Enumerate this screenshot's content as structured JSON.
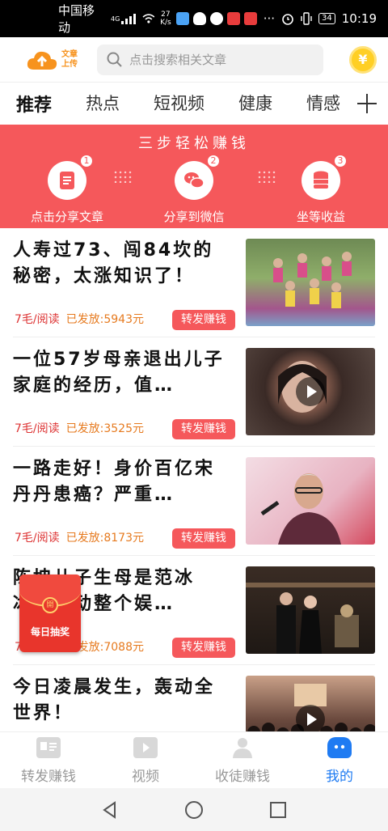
{
  "status_bar": {
    "carrier": "中国移动",
    "network": "4G",
    "speed_value": "27",
    "speed_unit": "K/s",
    "battery": "34",
    "time": "10:19"
  },
  "header": {
    "upload_label_line1": "文章",
    "upload_label_line2": "上传",
    "search_placeholder": "点击搜索相关文章",
    "coin_symbol": "¥"
  },
  "tabs": [
    {
      "label": "推荐",
      "active": true
    },
    {
      "label": "热点",
      "active": false
    },
    {
      "label": "短视频",
      "active": false
    },
    {
      "label": "健康",
      "active": false
    },
    {
      "label": "情感",
      "active": false
    }
  ],
  "banner": {
    "title": "三步轻松赚钱",
    "steps": [
      {
        "num": "1",
        "label": "点击分享文章",
        "icon": "document-icon"
      },
      {
        "num": "2",
        "label": "分享到微信",
        "icon": "wechat-icon"
      },
      {
        "num": "3",
        "label": "坐等收益",
        "icon": "coins-icon"
      }
    ]
  },
  "articles": [
    {
      "title": "人寿过73、闯84坎的秘密，太涨知识了！",
      "price": "7毛/阅读",
      "sent": "已发放:5943元",
      "share": "转发赚钱",
      "video": false,
      "thumb_color": "#7a9a5a"
    },
    {
      "title": "一位57岁母亲退出儿子家庭的经历，值…",
      "price": "7毛/阅读",
      "sent": "已发放:3525元",
      "share": "转发赚钱",
      "video": true,
      "thumb_color": "#4a3a36"
    },
    {
      "title": "一路走好！身价百亿宋丹丹患癌？严重…",
      "price": "7毛/阅读",
      "sent": "已发放:8173元",
      "share": "转发赚钱",
      "video": false,
      "thumb_color": "#e9c8d2"
    },
    {
      "title": "陈坤儿子生母是范冰冰？轰动整个娱…",
      "price": "7毛/阅读",
      "sent": "已发放:7088元",
      "share": "转发赚钱",
      "video": false,
      "thumb_color": "#2a211c"
    },
    {
      "title": "今日凌晨发生，轰动全世界！",
      "price": "",
      "sent": "",
      "share": "",
      "video": true,
      "thumb_color": "#5b3a30"
    }
  ],
  "envelope": {
    "seal": "開",
    "label": "每日抽奖"
  },
  "bottom_nav": [
    {
      "label": "转发赚钱",
      "icon": "share-earn-icon",
      "active": false
    },
    {
      "label": "视频",
      "icon": "video-icon",
      "active": false
    },
    {
      "label": "收徒赚钱",
      "icon": "person-icon",
      "active": false
    },
    {
      "label": "我的",
      "icon": "me-icon",
      "active": true
    }
  ],
  "colors": {
    "accent_red": "#f5585b",
    "nav_active": "#1f7bf2",
    "upload_orange": "#f7931e",
    "coin_yellow": "#ffcf25"
  }
}
